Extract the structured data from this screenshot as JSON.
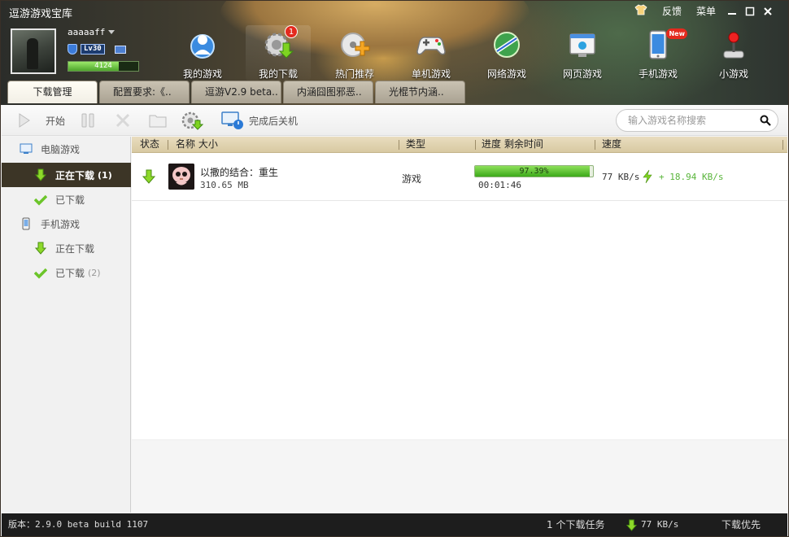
{
  "window": {
    "title": "逗游游戏宝库",
    "top_links": {
      "feedback": "反馈",
      "menu": "菜单"
    },
    "controls": {
      "minimize": "—",
      "maximize": "☐",
      "close": "✕"
    }
  },
  "user": {
    "name": "aaaaaff",
    "level": "Lv30",
    "xp_text": "4124",
    "xp_fraction": 0.72
  },
  "nav": [
    {
      "label": "我的游戏",
      "icon": "globe-people-icon"
    },
    {
      "label": "我的下载",
      "icon": "gear-download-icon",
      "badge": "1"
    },
    {
      "label": "热门推荐",
      "icon": "disc-plus-icon"
    },
    {
      "label": "单机游戏",
      "icon": "gamepad-icon"
    },
    {
      "label": "网络游戏",
      "icon": "network-globe-icon"
    },
    {
      "label": "网页游戏",
      "icon": "browser-icon"
    },
    {
      "label": "手机游戏",
      "icon": "phone-icon",
      "badge": "New"
    },
    {
      "label": "小游戏",
      "icon": "joystick-icon"
    }
  ],
  "tabs": [
    "下载管理",
    "配置要求:《..",
    "逗游V2.9 beta..",
    "内涵囧图邪恶..",
    "光棍节内涵.."
  ],
  "toolbar": {
    "start": "开始",
    "shutdown": "完成后关机",
    "search_placeholder": "输入游戏名称搜索"
  },
  "sidebar": {
    "pc_header": "电脑游戏",
    "pc_downloading": "正在下载",
    "pc_downloading_count": "(1)",
    "pc_downloaded": "已下载",
    "mobile_header": "手机游戏",
    "mobile_downloading": "正在下载",
    "mobile_downloaded": "已下载",
    "mobile_downloaded_count": "(2)"
  },
  "table": {
    "headers": {
      "status": "状态",
      "name": "名称 大小",
      "type": "类型",
      "progress": "进度 剩余时间",
      "speed": "速度"
    },
    "rows": [
      {
        "name": "以撒的结合：重生",
        "size": "310.65 MB",
        "type": "游戏",
        "progress_text": "97.39%",
        "progress": 0.9739,
        "remaining": "00:01:46",
        "speed": "77 KB/s",
        "boost": "+ 18.94 KB/s"
      }
    ]
  },
  "statusbar": {
    "version": "版本：2.9.0 beta build 1107",
    "tasks": "1 个下载任务",
    "speed": "77 KB/s",
    "priority": "下载优先"
  },
  "colors": {
    "accent_green": "#3caa1a",
    "badge_red": "#e42a1e",
    "sidebar_active": "#3c3526"
  }
}
